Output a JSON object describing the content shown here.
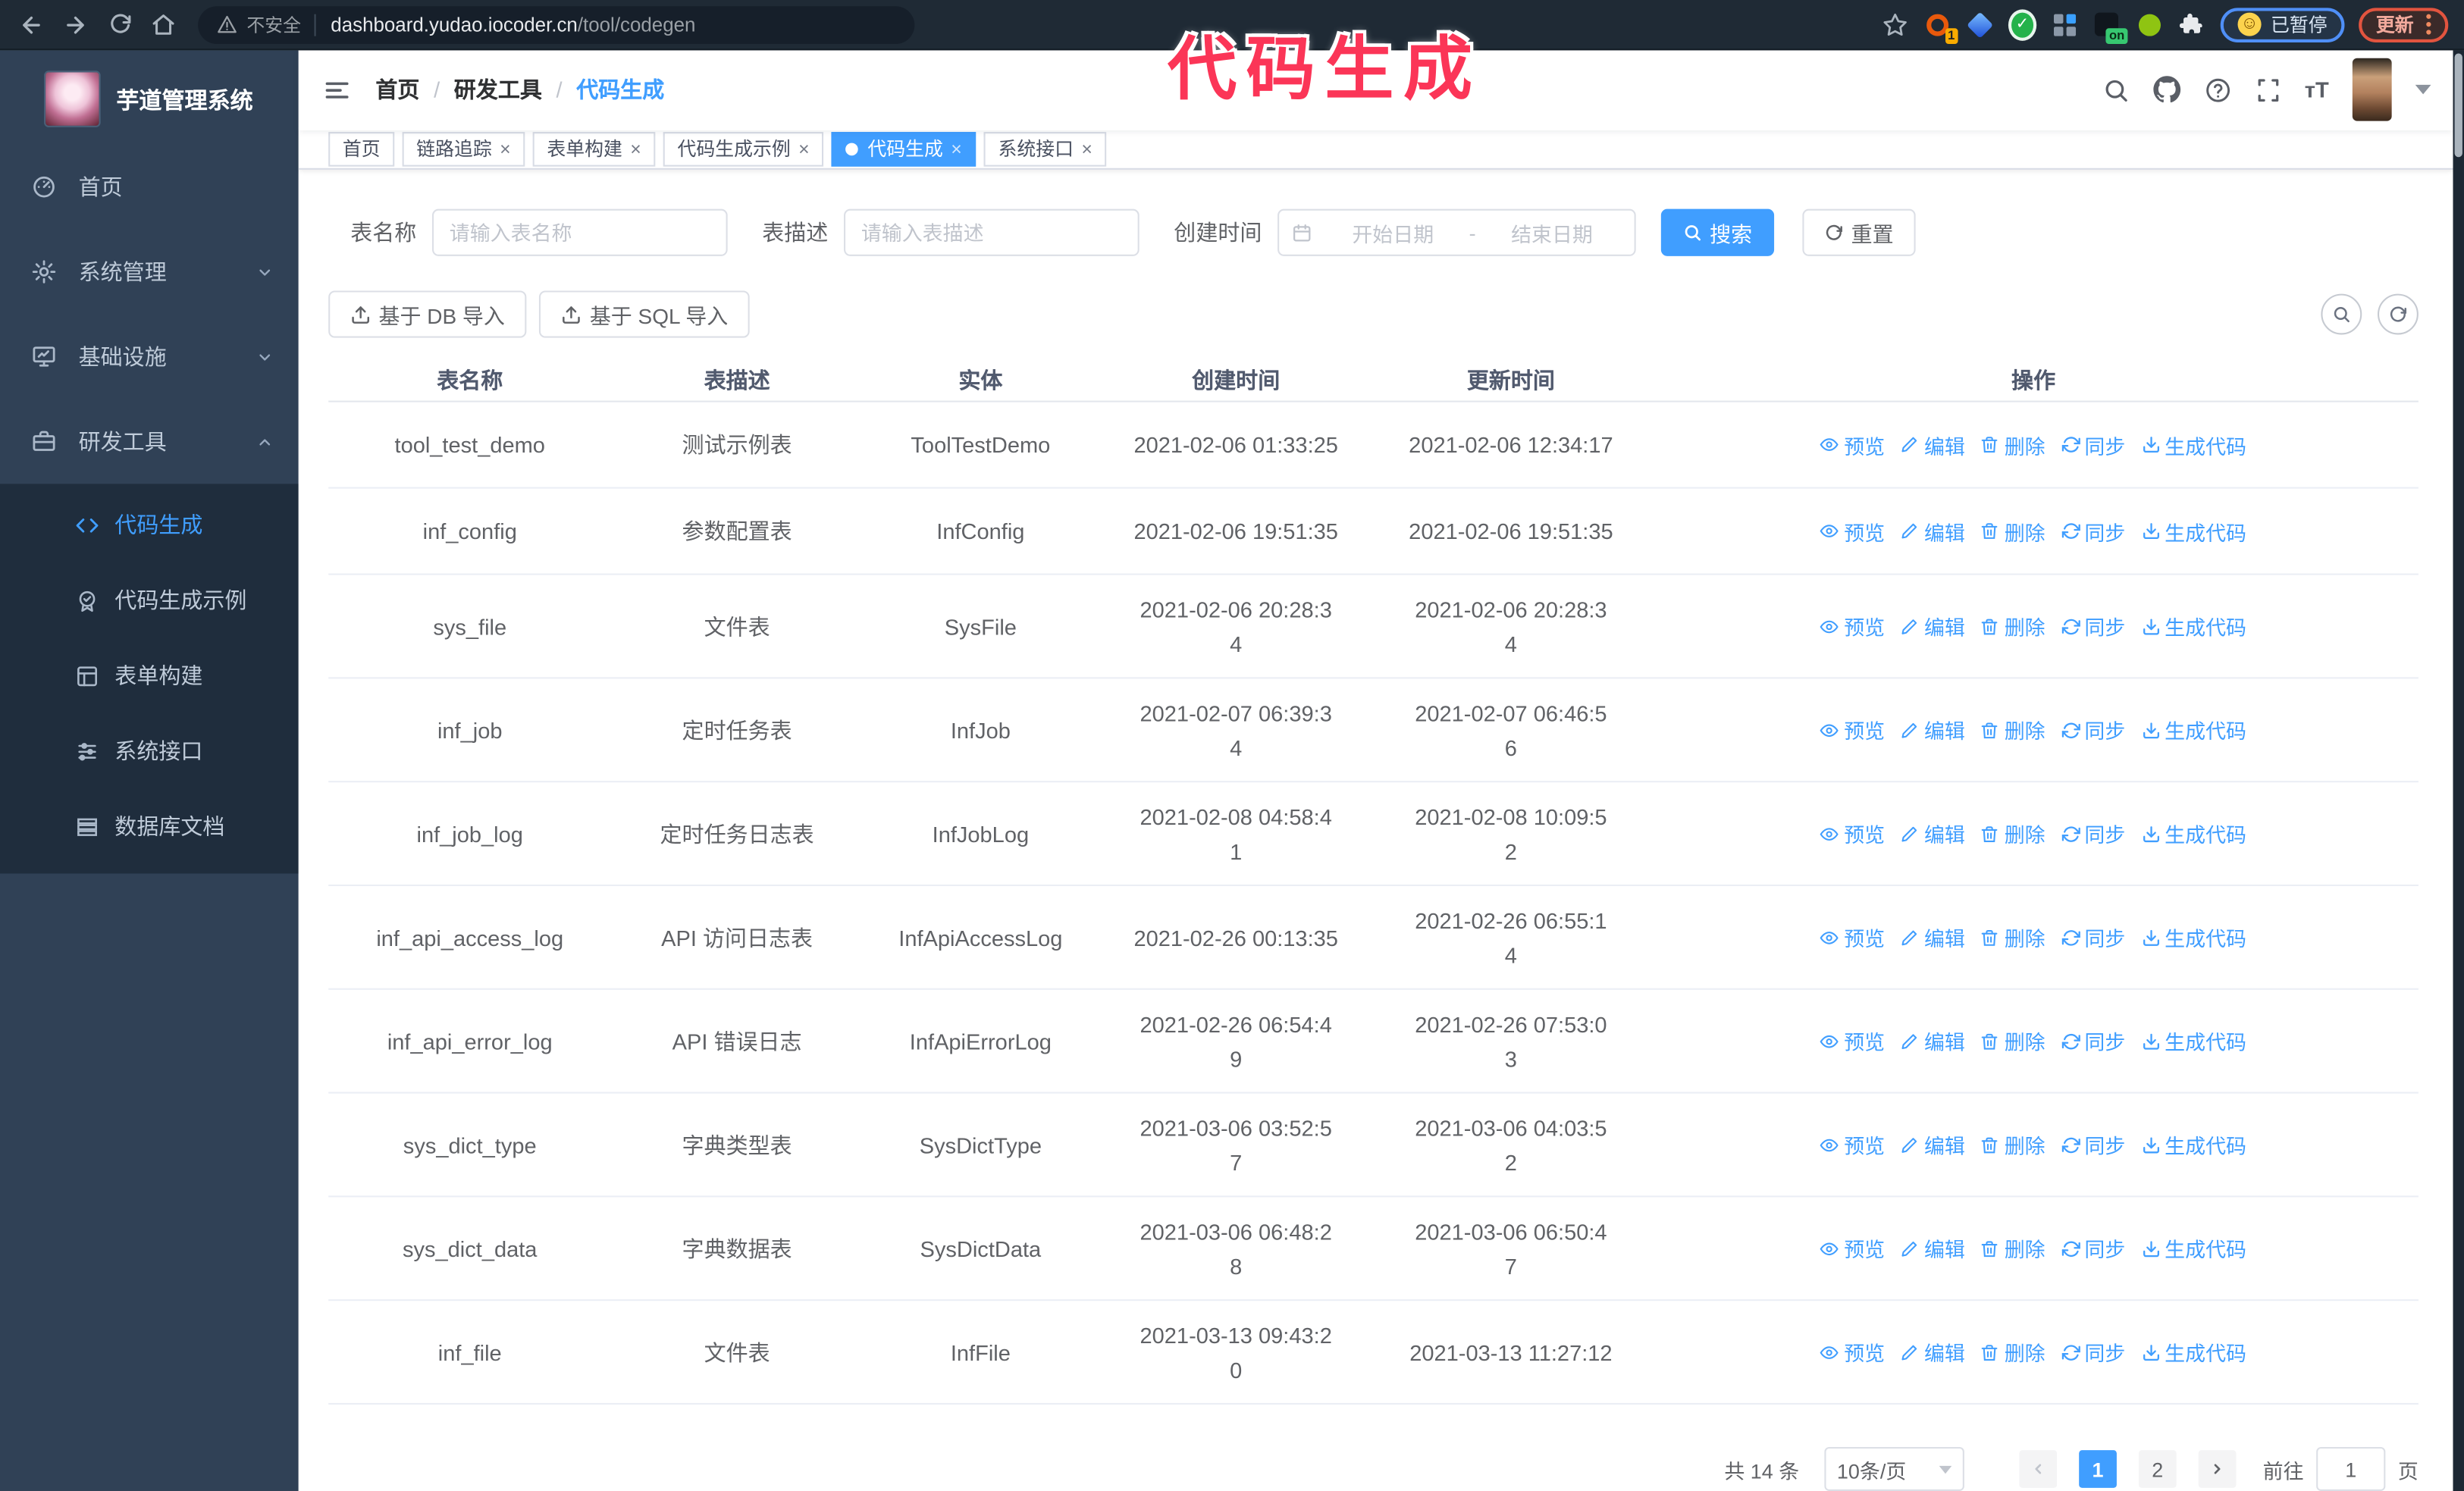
{
  "browser": {
    "security_label": "不安全",
    "url_host": "dashboard.yudao.iocoder.cn",
    "url_path": "/tool/codegen",
    "extension_badge_count": "1",
    "extension_badge_on": "on",
    "profile_paused_label": "已暂停",
    "update_label": "更新"
  },
  "annotation": {
    "text": "代码生成"
  },
  "sidebar": {
    "title": "芋道管理系统",
    "menu": {
      "home": "首页",
      "system": "系统管理",
      "infra": "基础设施",
      "devtools": "研发工具"
    },
    "submenu": [
      {
        "label": "代码生成",
        "active": true
      },
      {
        "label": "代码生成示例"
      },
      {
        "label": "表单构建"
      },
      {
        "label": "系统接口"
      },
      {
        "label": "数据库文档"
      }
    ]
  },
  "navbar": {
    "breadcrumb": {
      "0": "首页",
      "1": "研发工具",
      "2": "代码生成",
      "separator": "/"
    }
  },
  "tags": [
    {
      "label": "首页",
      "closable": false
    },
    {
      "label": "链路追踪",
      "closable": true
    },
    {
      "label": "表单构建",
      "closable": true
    },
    {
      "label": "代码生成示例",
      "closable": true
    },
    {
      "label": "代码生成",
      "closable": true,
      "active": true
    },
    {
      "label": "系统接口",
      "closable": true
    }
  ],
  "filters": {
    "table_name_label": "表名称",
    "table_name_placeholder": "请输入表名称",
    "table_desc_label": "表描述",
    "table_desc_placeholder": "请输入表描述",
    "create_time_label": "创建时间",
    "start_placeholder": "开始日期",
    "range_separator": "-",
    "end_placeholder": "结束日期",
    "search_label": "搜索",
    "reset_label": "重置"
  },
  "toolbar": {
    "import_db_label": "基于 DB 导入",
    "import_sql_label": "基于 SQL 导入"
  },
  "table": {
    "columns": [
      "表名称",
      "表描述",
      "实体",
      "创建时间",
      "更新时间",
      "操作"
    ],
    "actions": [
      {
        "label": "预览"
      },
      {
        "label": "编辑"
      },
      {
        "label": "删除"
      },
      {
        "label": "同步"
      },
      {
        "label": "生成代码"
      }
    ],
    "rows": [
      {
        "name": "tool_test_demo",
        "desc": "测试示例表",
        "entity": "ToolTestDemo",
        "create_lines": [
          "2021-02-06 01:33:25"
        ],
        "update_lines": [
          "2021-02-06 12:34:17"
        ]
      },
      {
        "name": "inf_config",
        "desc": "参数配置表",
        "entity": "InfConfig",
        "create_lines": [
          "2021-02-06 19:51:35"
        ],
        "update_lines": [
          "2021-02-06 19:51:35"
        ]
      },
      {
        "name": "sys_file",
        "desc": "文件表",
        "entity": "SysFile",
        "create_lines": [
          "2021-02-06 20:28:3",
          "4"
        ],
        "update_lines": [
          "2021-02-06 20:28:3",
          "4"
        ]
      },
      {
        "name": "inf_job",
        "desc": "定时任务表",
        "entity": "InfJob",
        "create_lines": [
          "2021-02-07 06:39:3",
          "4"
        ],
        "update_lines": [
          "2021-02-07 06:46:5",
          "6"
        ]
      },
      {
        "name": "inf_job_log",
        "desc": "定时任务日志表",
        "entity": "InfJobLog",
        "create_lines": [
          "2021-02-08 04:58:4",
          "1"
        ],
        "update_lines": [
          "2021-02-08 10:09:5",
          "2"
        ]
      },
      {
        "name": "inf_api_access_log",
        "desc": "API 访问日志表",
        "entity": "InfApiAccessLog",
        "create_lines": [
          "2021-02-26 00:13:35"
        ],
        "update_lines": [
          "2021-02-26 06:55:1",
          "4"
        ]
      },
      {
        "name": "inf_api_error_log",
        "desc": "API 错误日志",
        "entity": "InfApiErrorLog",
        "create_lines": [
          "2021-02-26 06:54:4",
          "9"
        ],
        "update_lines": [
          "2021-02-26 07:53:0",
          "3"
        ]
      },
      {
        "name": "sys_dict_type",
        "desc": "字典类型表",
        "entity": "SysDictType",
        "create_lines": [
          "2021-03-06 03:52:5",
          "7"
        ],
        "update_lines": [
          "2021-03-06 04:03:5",
          "2"
        ]
      },
      {
        "name": "sys_dict_data",
        "desc": "字典数据表",
        "entity": "SysDictData",
        "create_lines": [
          "2021-03-06 06:48:2",
          "8"
        ],
        "update_lines": [
          "2021-03-06 06:50:4",
          "7"
        ]
      },
      {
        "name": "inf_file",
        "desc": "文件表",
        "entity": "InfFile",
        "create_lines": [
          "2021-03-13 09:43:2",
          "0"
        ],
        "update_lines": [
          "2021-03-13 11:27:12"
        ]
      }
    ]
  },
  "pagination": {
    "total_text": "共 14 条",
    "page_size_label": "10条/页",
    "pages": [
      {
        "label": "1",
        "active": true
      },
      {
        "label": "2"
      }
    ],
    "goto_label": "前往",
    "goto_value": "1",
    "goto_unit": "页"
  }
}
